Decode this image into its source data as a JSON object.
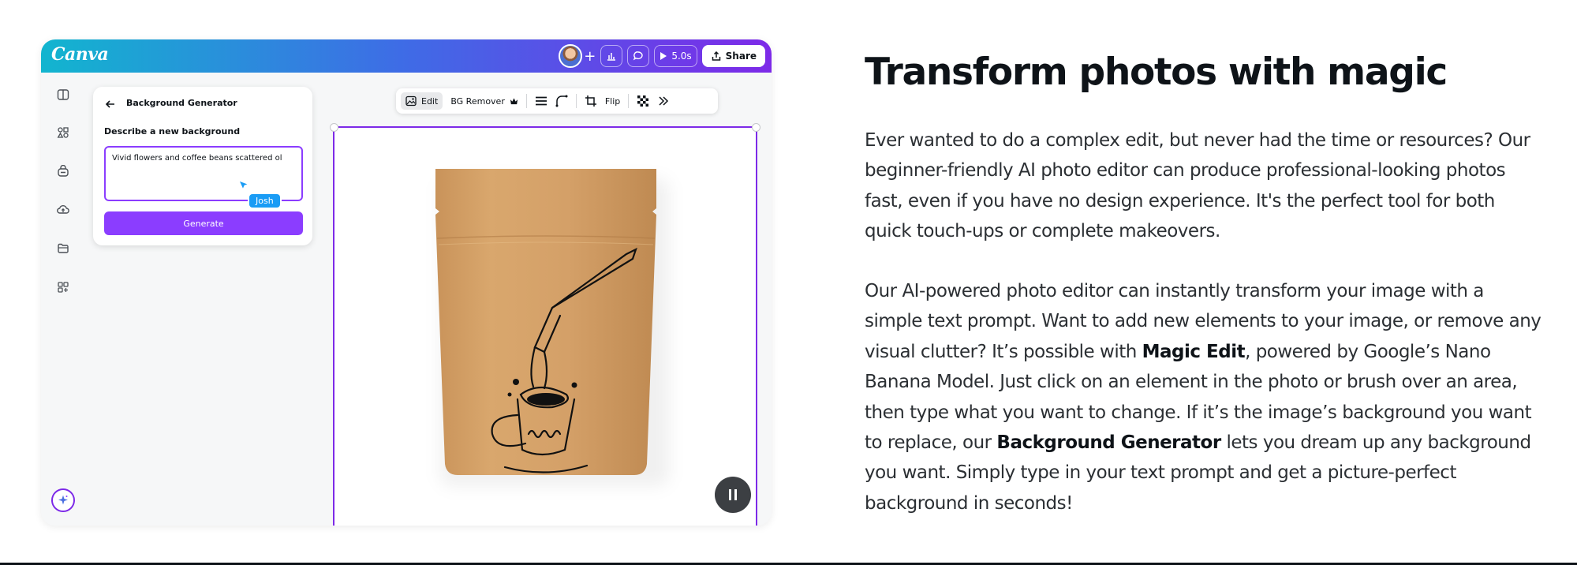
{
  "app": {
    "logo": "Canva",
    "timer": "5.0s",
    "share_label": "Share",
    "panel": {
      "title": "Background Generator",
      "label": "Describe a new background",
      "prompt_value": "Vivid flowers and coffee beans scattered ol",
      "collaborator": "Josh",
      "generate_label": "Generate"
    },
    "toolbar": {
      "edit_label": "Edit",
      "bg_remover_label": "BG Remover",
      "flip_label": "Flip"
    },
    "colors": {
      "accent": "#8b3dff",
      "gradient_start": "#12b5cf",
      "gradient_end": "#7d2ae8",
      "collab_tag": "#1a9cf5"
    },
    "icons": {
      "rail": [
        "layout-icon",
        "elements-icon",
        "brand-icon",
        "upload-icon",
        "folder-icon",
        "apps-icon"
      ],
      "magic": "magic-sparkle-icon"
    }
  },
  "content": {
    "heading": "Transform photos with magic",
    "p1": "Ever wanted to do a complex edit, but never had the time or resources? Our beginner-friendly AI photo editor can produce professional-looking photos fast, even if you have no design experience. It's the perfect tool for both quick touch-ups or complete makeovers.",
    "p2": {
      "t1": "Our AI-powered photo editor can instantly transform your image with a simple text prompt. Want to add new elements to your image, or remove any visual clutter? It’s possible with ",
      "b1": "Magic Edit",
      "t2": ", powered by Google’s Nano Banana Model. Just click on an element in the photo or brush over an area, then type what you want to change. If it’s the image’s background you want to replace, our ",
      "b2": "Background Generator",
      "t3": " lets you dream up any background you want. Simply type in your text prompt and get a picture-perfect background in seconds!"
    }
  }
}
